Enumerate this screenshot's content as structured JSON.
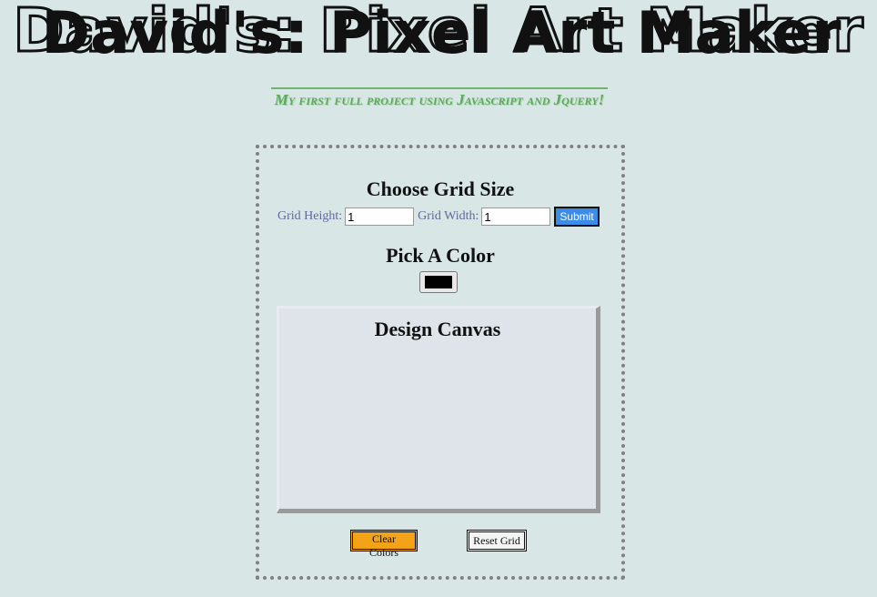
{
  "header": {
    "title": "David's: Pixel Art Maker",
    "subtitle": "My first full project using Javascript and Jquery!"
  },
  "grid_size": {
    "heading": "Choose Grid Size",
    "height_label": "Grid Height:",
    "height_value": "1",
    "width_label": "Grid Width:",
    "width_value": "1",
    "submit_label": "Submit"
  },
  "color": {
    "heading": "Pick A Color",
    "selected": "#000000"
  },
  "canvas": {
    "title": "Design Canvas"
  },
  "actions": {
    "clear_label": "Clear Colors",
    "reset_label": "Reset Grid"
  },
  "colors": {
    "background": "#d9e6e6",
    "subtitle": "#5daa5d",
    "submit": "#3b8be8",
    "clear": "#f2a317",
    "canvas": "#dfe3ea"
  }
}
